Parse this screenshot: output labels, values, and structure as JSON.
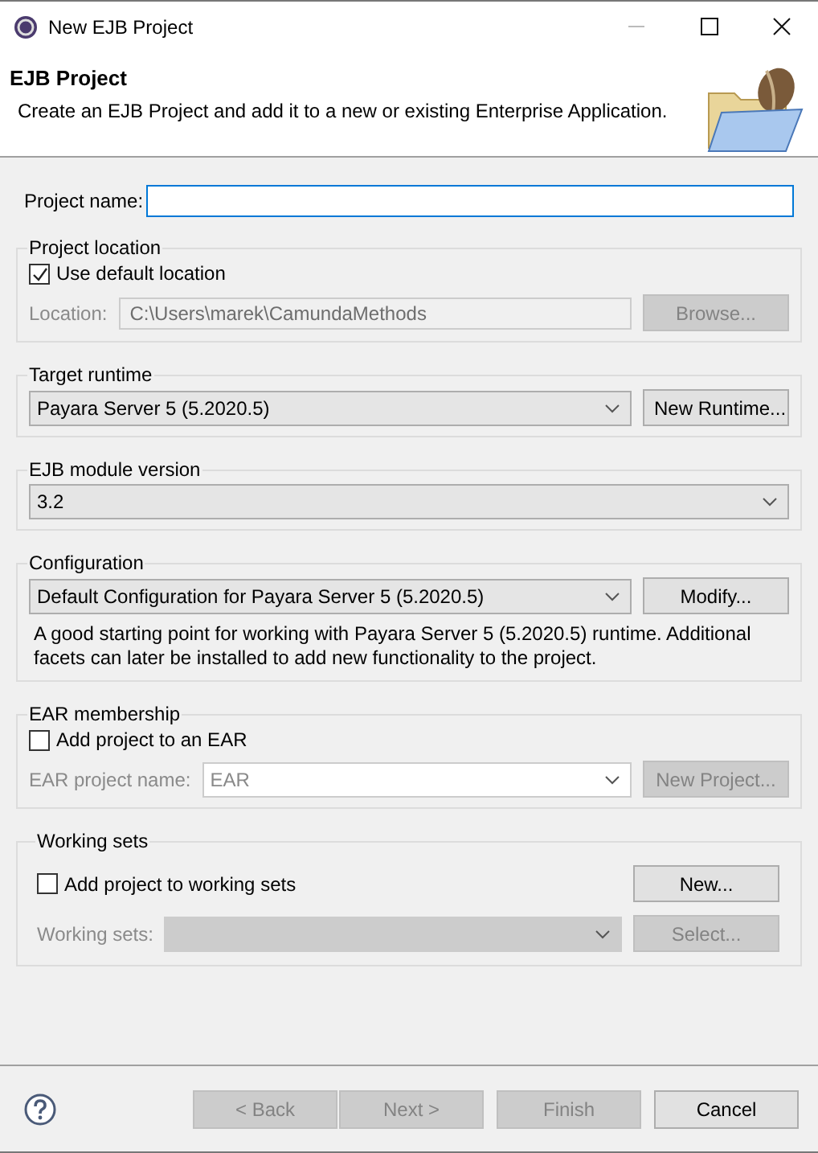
{
  "window": {
    "title": "New EJB Project"
  },
  "header": {
    "title": "EJB Project",
    "description": "Create an EJB Project and add it to a new or existing Enterprise Application."
  },
  "project_name": {
    "label": "Project name:",
    "focused": true
  },
  "project_location": {
    "title": "Project location",
    "use_default": {
      "label": "Use default location",
      "checked": true
    },
    "location": {
      "label": "Location:",
      "value": "C:\\Users\\marek\\CamundaMethods",
      "disabled": true
    },
    "browse_button": {
      "label": "Browse...",
      "disabled": true
    }
  },
  "target_runtime": {
    "title": "Target runtime",
    "value": "Payara Server 5 (5.2020.5)",
    "button": {
      "label": "New Runtime...",
      "disabled": false
    }
  },
  "ejb_module_version": {
    "title": "EJB module version",
    "value": "3.2"
  },
  "configuration": {
    "title": "Configuration",
    "value": "Default Configuration for Payara Server 5 (5.2020.5)",
    "button": {
      "label": "Modify...",
      "disabled": false
    },
    "description": "A good starting point for working with Payara Server 5 (5.2020.5) runtime. Additional facets can later be installed to add new functionality to the project."
  },
  "ear_membership": {
    "title": "EAR membership",
    "add": {
      "label": "Add project to an EAR",
      "checked": false
    },
    "project_name": {
      "label": "EAR project name:",
      "value": "EAR",
      "disabled": true
    },
    "button": {
      "label": "New Project...",
      "disabled": true
    }
  },
  "working_sets": {
    "title": "Working sets",
    "add": {
      "label": "Add project to working sets",
      "checked": false
    },
    "new_button": {
      "label": "New...",
      "disabled": false
    },
    "sets": {
      "label": "Working sets:",
      "disabled": true
    },
    "select_button": {
      "label": "Select...",
      "disabled": true
    }
  },
  "buttons": [
    {
      "label": "< Back",
      "disabled": true
    },
    {
      "label": "Next >",
      "disabled": true
    },
    {
      "label": "Finish",
      "disabled": true
    },
    {
      "label": "Cancel",
      "disabled": false
    }
  ]
}
